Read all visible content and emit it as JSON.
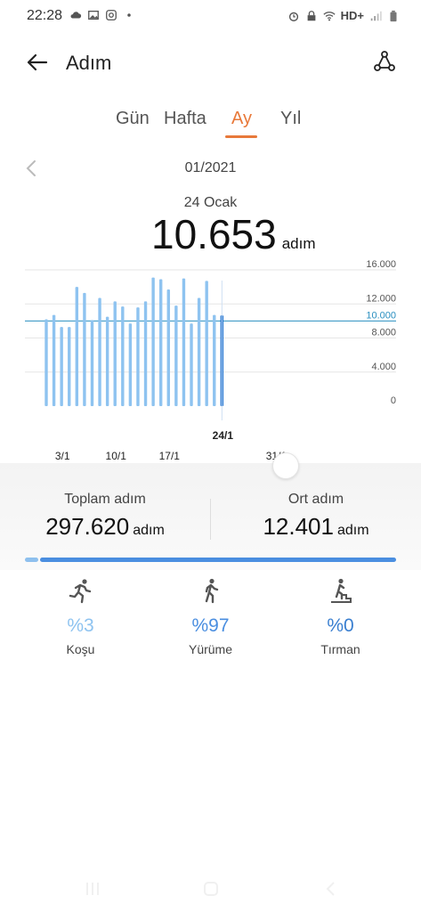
{
  "status_bar": {
    "time": "22:28",
    "network": "HD+",
    "icons": [
      "cloud-icon",
      "image-icon",
      "instagram-icon",
      "dot-icon",
      "alarm-icon",
      "lock-icon",
      "wifi-icon",
      "signal-icon",
      "battery-icon"
    ]
  },
  "header": {
    "title": "Adım",
    "back_icon": "arrow-left-icon",
    "share_icon": "share-icon"
  },
  "tabs": [
    {
      "label": "Gün",
      "active": false
    },
    {
      "label": "Hafta",
      "active": false
    },
    {
      "label": "Ay",
      "active": true
    },
    {
      "label": "Yıl",
      "active": false
    }
  ],
  "period": {
    "label": "01/2021",
    "selected_date": "24 Ocak",
    "selected_value": "10.653",
    "unit": "adım"
  },
  "chart_data": {
    "type": "bar",
    "categories": [
      "1/1",
      "2/1",
      "3/1",
      "4/1",
      "5/1",
      "6/1",
      "7/1",
      "8/1",
      "9/1",
      "10/1",
      "11/1",
      "12/1",
      "13/1",
      "14/1",
      "15/1",
      "16/1",
      "17/1",
      "18/1",
      "19/1",
      "20/1",
      "21/1",
      "22/1",
      "23/1",
      "24/1"
    ],
    "values": [
      10200,
      10700,
      9300,
      9300,
      14000,
      13300,
      10100,
      12700,
      10500,
      12300,
      11700,
      9700,
      11600,
      12300,
      15100,
      14900,
      13700,
      11800,
      15000,
      9700,
      12700,
      14700,
      10700,
      10653
    ],
    "selected_index": 23,
    "x_tick_labels": [
      "3/1",
      "10/1",
      "17/1",
      "24/1",
      "31/1"
    ],
    "x_tick_days": [
      3,
      10,
      17,
      24,
      31
    ],
    "y_tick_labels": [
      "16.000",
      "12.000",
      "10.000",
      "8.000",
      "4.000",
      "0"
    ],
    "y_ticks": [
      16000,
      12000,
      10000,
      8000,
      4000,
      0
    ],
    "goal": 10000,
    "ylim": [
      0,
      16000
    ],
    "colors": {
      "bar": "#8ec3f0",
      "selected": "#1a6fd0",
      "goal": "#2a8fc0",
      "grid": "#e6e6e6"
    }
  },
  "summary": {
    "total_label": "Toplam adım",
    "total_value": "297.620",
    "total_unit": "adım",
    "avg_label": "Ort adım",
    "avg_value": "12.401",
    "avg_unit": "adım"
  },
  "progress": {
    "running_fraction": 0.03,
    "walking_fraction": 0.97
  },
  "activities": [
    {
      "icon": "running-icon",
      "percent": "%3",
      "name": "Koşu",
      "color": "#8ec3f0"
    },
    {
      "icon": "walking-icon",
      "percent": "%97",
      "name": "Yürüme",
      "color": "#4a8ee0"
    },
    {
      "icon": "climbing-icon",
      "percent": "%0",
      "name": "Tırman",
      "color": "#3a7fd0"
    }
  ],
  "nav_icons": [
    "recent-apps-icon",
    "home-icon",
    "back-icon"
  ]
}
